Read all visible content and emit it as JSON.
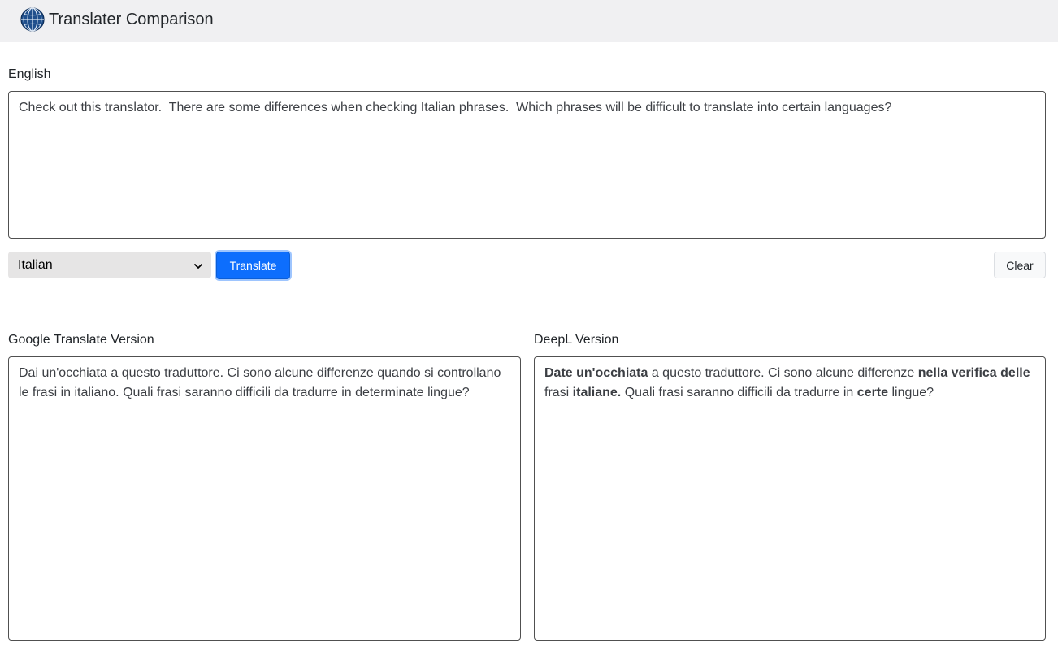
{
  "header": {
    "title": "Translater Comparison",
    "icon": "globe-icon"
  },
  "source": {
    "label": "English",
    "text": "Check out this translator.  There are some differences when checking Italian phrases.  Which phrases will be difficult to translate into certain languages?"
  },
  "controls": {
    "language_selected": "Italian",
    "translate_label": "Translate",
    "clear_label": "Clear"
  },
  "google": {
    "label": "Google Translate Version",
    "text": "Dai un'occhiata a questo traduttore. Ci sono alcune differenze quando si controllano le frasi in italiano. Quali frasi saranno difficili da tradurre in determinate lingue?"
  },
  "deepl": {
    "label": "DeepL Version",
    "segments": [
      {
        "text": "Date un'occhiata",
        "bold": true
      },
      {
        "text": " a questo traduttore. Ci sono alcune differenze ",
        "bold": false
      },
      {
        "text": "nella verifica delle",
        "bold": true
      },
      {
        "text": " frasi ",
        "bold": false
      },
      {
        "text": "italiane.",
        "bold": true
      },
      {
        "text": " Quali frasi saranno difficili da tradurre in ",
        "bold": false
      },
      {
        "text": "certe",
        "bold": true
      },
      {
        "text": " lingue?",
        "bold": false
      }
    ]
  },
  "colors": {
    "primary": "#0d6efd",
    "navbar_bg": "#f0f0f2"
  }
}
